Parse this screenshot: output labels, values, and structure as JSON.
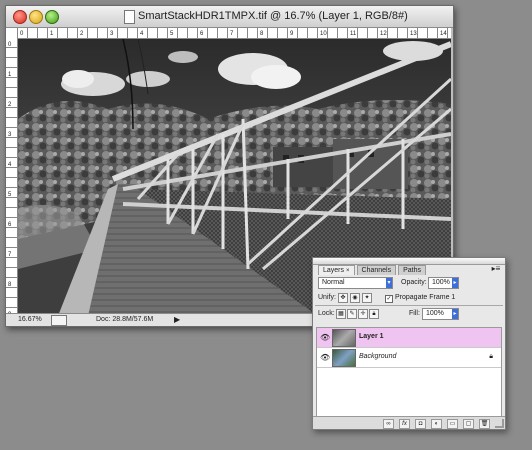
{
  "document": {
    "title": "SmartStackHDR1TMPX.tif @ 16.7% (Layer 1, RGB/8#)",
    "zoom": "16.67%",
    "doc_size": "Doc: 28.8M/57.6M",
    "ruler_top_labels": [
      "0",
      "1",
      "2",
      "3",
      "4",
      "5",
      "6",
      "7",
      "8",
      "9",
      "10",
      "11",
      "12",
      "13",
      "14"
    ],
    "ruler_left_labels": [
      "0",
      "1",
      "2",
      "3",
      "4",
      "5",
      "6",
      "7",
      "8",
      "9"
    ]
  },
  "layers_panel": {
    "tabs": [
      {
        "label": "Layers"
      },
      {
        "label": "Channels"
      },
      {
        "label": "Paths"
      }
    ],
    "blend_mode": "Normal",
    "opacity_label": "Opacity:",
    "opacity_value": "100%",
    "unify_label": "Unify:",
    "propagate_label": "Propagate Frame 1",
    "lock_label": "Lock:",
    "fill_label": "Fill:",
    "fill_value": "100%",
    "layers": [
      {
        "name": "Layer 1",
        "selected": true
      },
      {
        "name": "Background",
        "selected": false,
        "locked": true
      }
    ],
    "footer_buttons": [
      "link-icon",
      "fx-icon",
      "mask-icon",
      "adjustment-icon",
      "folder-icon",
      "new-layer-icon",
      "trash-icon"
    ]
  },
  "colors": {
    "desktop": "#8c8c8c",
    "selected_layer": "#f0c4f0",
    "select_arrow": "#3d6fd6"
  }
}
